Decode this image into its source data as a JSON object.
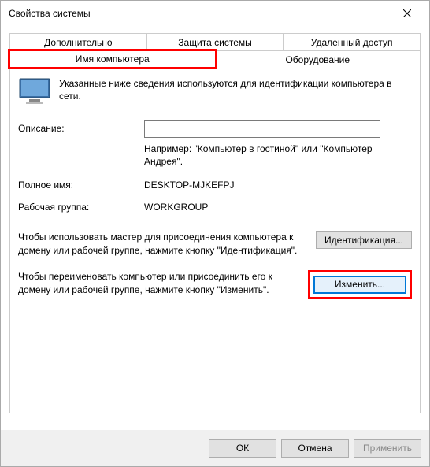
{
  "title": "Свойства системы",
  "tabs_row1": {
    "advanced": "Дополнительно",
    "protection": "Защита системы",
    "remote": "Удаленный доступ"
  },
  "tabs_row2": {
    "computer_name": "Имя компьютера",
    "hardware": "Оборудование"
  },
  "intro": "Указанные ниже сведения используются для идентификации компьютера в сети.",
  "description_label": "Описание:",
  "description_value": "",
  "description_hint": "Например: \"Компьютер в гостиной\" или \"Компьютер Андрея\".",
  "fullname_label": "Полное имя:",
  "fullname_value": "DESKTOP-MJKEFPJ",
  "workgroup_label": "Рабочая группа:",
  "workgroup_value": "WORKGROUP",
  "ident_text": "Чтобы использовать мастер для присоединения компьютера к домену или рабочей группе, нажмите кнопку \"Идентификация\".",
  "ident_button": "Идентификация...",
  "change_text": "Чтобы переименовать компьютер или присоединить его к домену или рабочей группе, нажмите кнопку \"Изменить\".",
  "change_button": "Изменить...",
  "buttons": {
    "ok": "ОК",
    "cancel": "Отмена",
    "apply": "Применить"
  }
}
